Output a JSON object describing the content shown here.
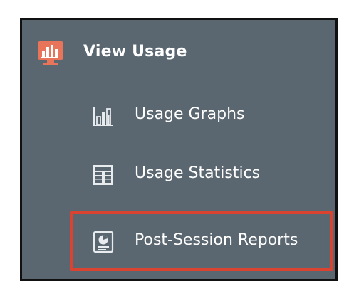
{
  "menu": {
    "header": {
      "label": "View Usage",
      "icon": "usage-monitor-icon",
      "icon_color": "#e8745a"
    },
    "items": [
      {
        "label": "Usage Graphs",
        "icon": "bar-chart-icon"
      },
      {
        "label": "Usage Statistics",
        "icon": "table-icon"
      },
      {
        "label": "Post-Session Reports",
        "icon": "report-icon",
        "highlighted": true
      }
    ]
  },
  "colors": {
    "panel_background": "#5b6770",
    "text": "#ffffff",
    "highlight": "#d9432f",
    "border": "#111111"
  }
}
